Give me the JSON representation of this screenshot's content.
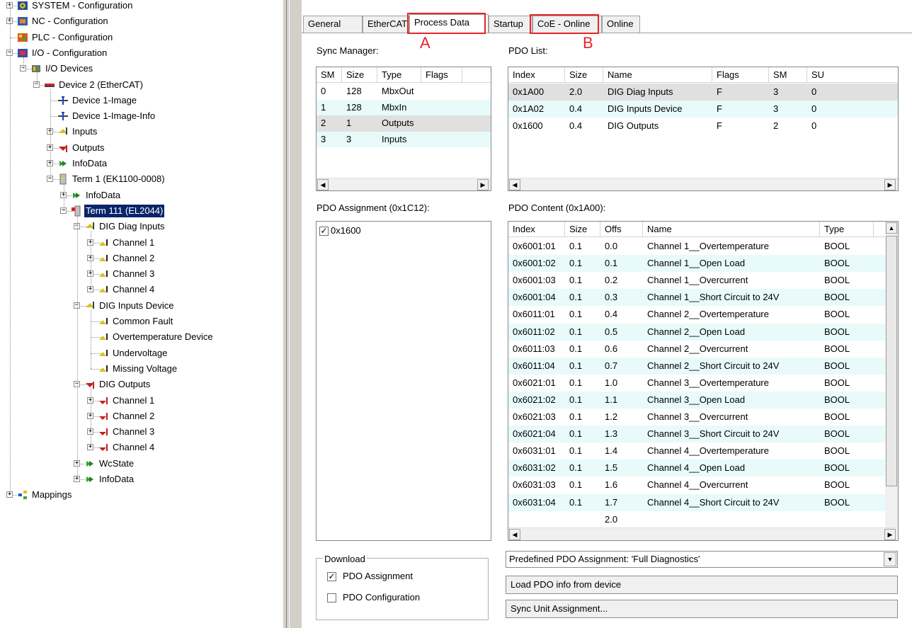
{
  "tree": {
    "items": [
      {
        "label": "SYSTEM - Configuration",
        "level": 0,
        "exp": "+",
        "icon": "system-icon"
      },
      {
        "label": "NC - Configuration",
        "level": 0,
        "exp": "+",
        "icon": "nc-icon"
      },
      {
        "label": "PLC - Configuration",
        "level": 0,
        "exp": "",
        "icon": "plc-icon"
      },
      {
        "label": "I/O - Configuration",
        "level": 0,
        "exp": "−",
        "icon": "io-config-icon"
      },
      {
        "label": "I/O Devices",
        "level": 1,
        "exp": "−",
        "icon": "io-devices-icon"
      },
      {
        "label": "Device 2 (EtherCAT)",
        "level": 2,
        "exp": "−",
        "icon": "ethercat-device-icon"
      },
      {
        "label": "Device 1-Image",
        "level": 3,
        "exp": "",
        "icon": "image-icon"
      },
      {
        "label": "Device 1-Image-Info",
        "level": 3,
        "exp": "",
        "icon": "image-info-icon"
      },
      {
        "label": "Inputs",
        "level": 3,
        "exp": "+",
        "icon": "inputs-icon"
      },
      {
        "label": "Outputs",
        "level": 3,
        "exp": "+",
        "icon": "outputs-icon"
      },
      {
        "label": "InfoData",
        "level": 3,
        "exp": "+",
        "icon": "infodata-icon"
      },
      {
        "label": "Term 1 (EK1100-0008)",
        "level": 3,
        "exp": "−",
        "icon": "terminal-icon"
      },
      {
        "label": "InfoData",
        "level": 4,
        "exp": "+",
        "icon": "infodata-icon"
      },
      {
        "label": "Term 111 (EL2044)",
        "level": 4,
        "exp": "−",
        "icon": "terminal-red-icon",
        "selected": true
      },
      {
        "label": "DIG Diag Inputs",
        "level": 5,
        "exp": "−",
        "icon": "inputs-icon"
      },
      {
        "label": "Channel 1",
        "level": 6,
        "exp": "+",
        "icon": "input-var-icon"
      },
      {
        "label": "Channel 2",
        "level": 6,
        "exp": "+",
        "icon": "input-var-icon"
      },
      {
        "label": "Channel 3",
        "level": 6,
        "exp": "+",
        "icon": "input-var-icon"
      },
      {
        "label": "Channel 4",
        "level": 6,
        "exp": "+",
        "icon": "input-var-icon"
      },
      {
        "label": "DIG Inputs Device",
        "level": 5,
        "exp": "−",
        "icon": "inputs-icon"
      },
      {
        "label": "Common Fault",
        "level": 6,
        "exp": "",
        "icon": "input-var-icon"
      },
      {
        "label": "Overtemperature Device",
        "level": 6,
        "exp": "",
        "icon": "input-var-icon"
      },
      {
        "label": "Undervoltage",
        "level": 6,
        "exp": "",
        "icon": "input-var-icon"
      },
      {
        "label": "Missing Voltage",
        "level": 6,
        "exp": "",
        "icon": "input-var-icon"
      },
      {
        "label": "DIG Outputs",
        "level": 5,
        "exp": "−",
        "icon": "outputs-icon"
      },
      {
        "label": "Channel 1",
        "level": 6,
        "exp": "+",
        "icon": "output-var-icon"
      },
      {
        "label": "Channel 2",
        "level": 6,
        "exp": "+",
        "icon": "output-var-icon"
      },
      {
        "label": "Channel 3",
        "level": 6,
        "exp": "+",
        "icon": "output-var-icon"
      },
      {
        "label": "Channel 4",
        "level": 6,
        "exp": "+",
        "icon": "output-var-icon"
      },
      {
        "label": "WcState",
        "level": 5,
        "exp": "+",
        "icon": "infodata-icon"
      },
      {
        "label": "InfoData",
        "level": 5,
        "exp": "+",
        "icon": "infodata-icon"
      },
      {
        "label": "Mappings",
        "level": 0,
        "exp": "+",
        "icon": "mappings-icon"
      }
    ]
  },
  "tabs": [
    {
      "label": "General"
    },
    {
      "label": "EtherCAT"
    },
    {
      "label": "Process Data",
      "active": true
    },
    {
      "label": "Startup"
    },
    {
      "label": "CoE - Online"
    },
    {
      "label": "Online"
    }
  ],
  "annotations": {
    "a": "A",
    "b": "B"
  },
  "sync_manager": {
    "title": "Sync Manager:",
    "columns": [
      "SM",
      "Size",
      "Type",
      "Flags"
    ],
    "rows": [
      [
        "0",
        "128",
        "MbxOut",
        ""
      ],
      [
        "1",
        "128",
        "MbxIn",
        ""
      ],
      [
        "2",
        "1",
        "Outputs",
        ""
      ],
      [
        "3",
        "3",
        "Inputs",
        ""
      ]
    ]
  },
  "pdo_list": {
    "title": "PDO List:",
    "columns": [
      "Index",
      "Size",
      "Name",
      "Flags",
      "SM",
      "SU"
    ],
    "rows": [
      [
        "0x1A00",
        "2.0",
        "DIG Diag Inputs",
        "F",
        "3",
        "0"
      ],
      [
        "0x1A02",
        "0.4",
        "DIG Inputs Device",
        "F",
        "3",
        "0"
      ],
      [
        "0x1600",
        "0.4",
        "DIG Outputs",
        "F",
        "2",
        "0"
      ]
    ]
  },
  "pdo_assignment": {
    "title": "PDO Assignment (0x1C12):",
    "items": [
      {
        "label": "0x1600",
        "checked": true
      }
    ]
  },
  "pdo_content": {
    "title": "PDO Content (0x1A00):",
    "columns": [
      "Index",
      "Size",
      "Offs",
      "Name",
      "Type"
    ],
    "rows": [
      [
        "0x6001:01",
        "0.1",
        "0.0",
        "Channel 1__Overtemperature",
        "BOOL"
      ],
      [
        "0x6001:02",
        "0.1",
        "0.1",
        "Channel 1__Open Load",
        "BOOL"
      ],
      [
        "0x6001:03",
        "0.1",
        "0.2",
        "Channel 1__Overcurrent",
        "BOOL"
      ],
      [
        "0x6001:04",
        "0.1",
        "0.3",
        "Channel 1__Short Circuit to 24V",
        "BOOL"
      ],
      [
        "0x6011:01",
        "0.1",
        "0.4",
        "Channel 2__Overtemperature",
        "BOOL"
      ],
      [
        "0x6011:02",
        "0.1",
        "0.5",
        "Channel 2__Open Load",
        "BOOL"
      ],
      [
        "0x6011:03",
        "0.1",
        "0.6",
        "Channel 2__Overcurrent",
        "BOOL"
      ],
      [
        "0x6011:04",
        "0.1",
        "0.7",
        "Channel 2__Short Circuit to 24V",
        "BOOL"
      ],
      [
        "0x6021:01",
        "0.1",
        "1.0",
        "Channel 3__Overtemperature",
        "BOOL"
      ],
      [
        "0x6021:02",
        "0.1",
        "1.1",
        "Channel 3__Open Load",
        "BOOL"
      ],
      [
        "0x6021:03",
        "0.1",
        "1.2",
        "Channel 3__Overcurrent",
        "BOOL"
      ],
      [
        "0x6021:04",
        "0.1",
        "1.3",
        "Channel 3__Short Circuit to 24V",
        "BOOL"
      ],
      [
        "0x6031:01",
        "0.1",
        "1.4",
        "Channel 4__Overtemperature",
        "BOOL"
      ],
      [
        "0x6031:02",
        "0.1",
        "1.5",
        "Channel 4__Open Load",
        "BOOL"
      ],
      [
        "0x6031:03",
        "0.1",
        "1.6",
        "Channel 4__Overcurrent",
        "BOOL"
      ],
      [
        "0x6031:04",
        "0.1",
        "1.7",
        "Channel 4__Short Circuit to 24V",
        "BOOL"
      ],
      [
        "",
        "",
        "2.0",
        "",
        ""
      ]
    ]
  },
  "download": {
    "title": "Download",
    "pdo_assignment": {
      "label": "PDO Assignment",
      "checked": true
    },
    "pdo_configuration": {
      "label": "PDO Configuration",
      "checked": false
    }
  },
  "predefined_combo": {
    "value": "Predefined PDO Assignment: 'Full Diagnostics'"
  },
  "buttons": {
    "load_pdo": "Load PDO info from device",
    "sync_unit": "Sync Unit Assignment..."
  },
  "colors": {
    "selection": "#0a246a",
    "alt_row": "#e8fafa",
    "annotation": "#e8232a"
  }
}
